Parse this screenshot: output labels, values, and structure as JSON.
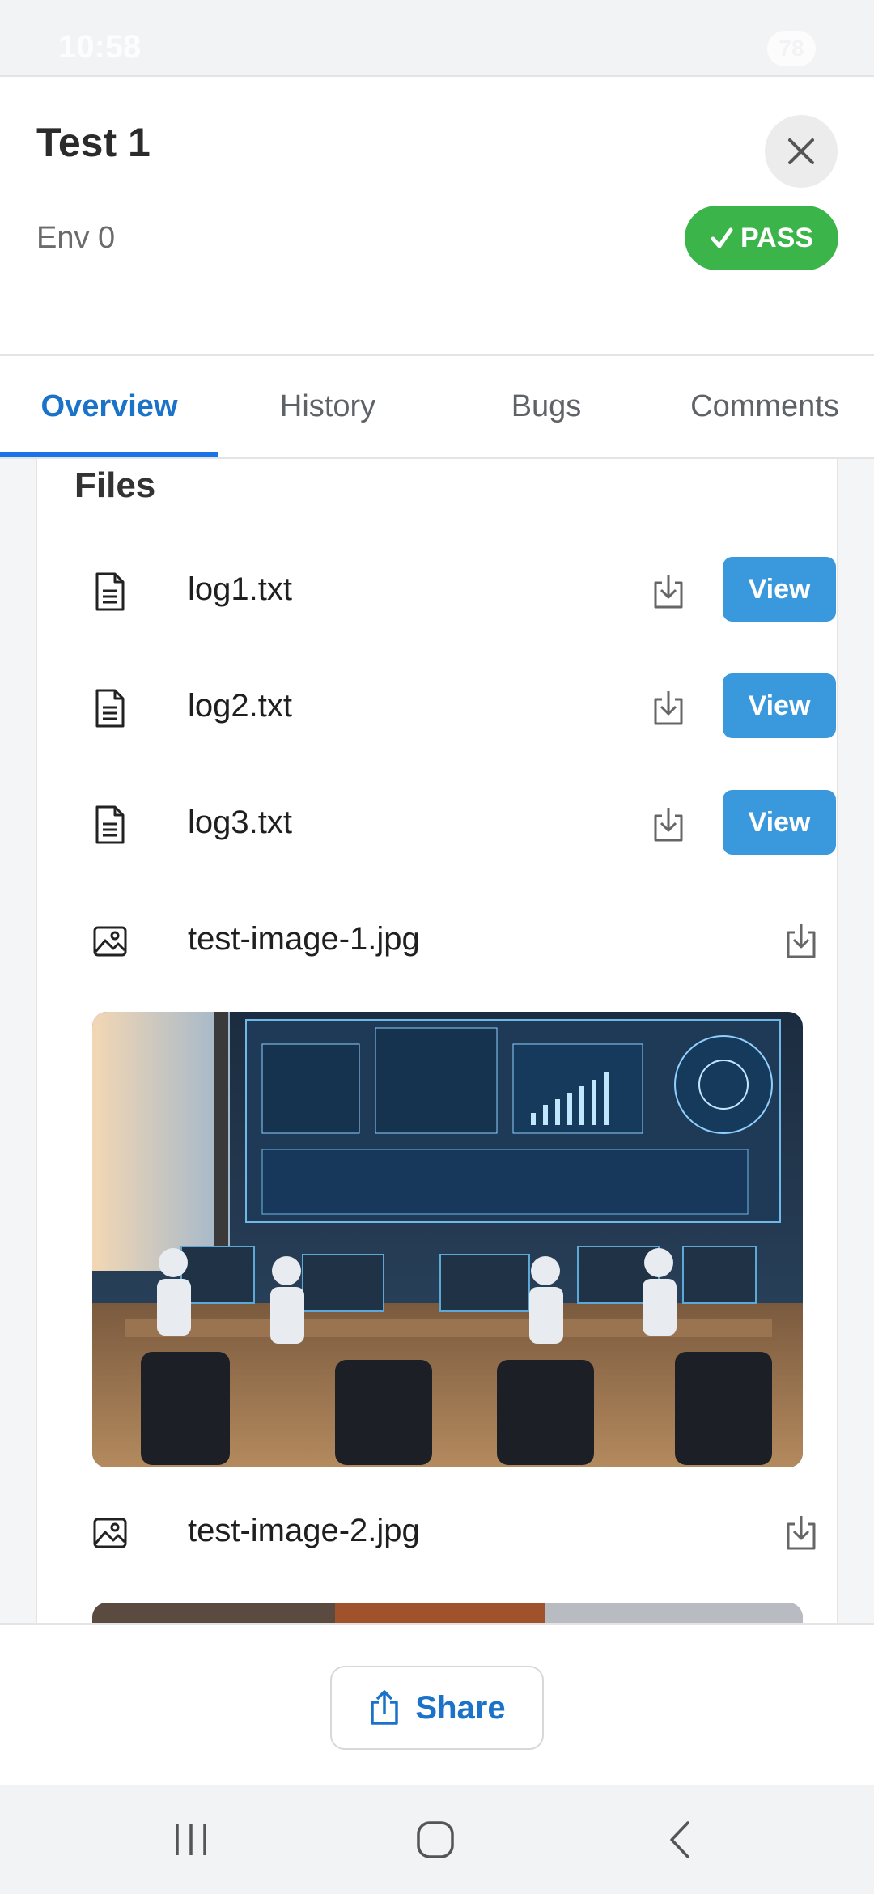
{
  "status_bar": {
    "time": "10:58",
    "battery": "78"
  },
  "header": {
    "title": "Test 1",
    "subtitle": "Env 0",
    "status_badge": "PASS",
    "status_color": "#3bb54a"
  },
  "tabs": [
    {
      "label": "Overview",
      "active": true
    },
    {
      "label": "History",
      "active": false
    },
    {
      "label": "Bugs",
      "active": false
    },
    {
      "label": "Comments",
      "active": false
    }
  ],
  "files": {
    "heading": "Files",
    "text_files": [
      {
        "name": "log1.txt",
        "view_label": "View"
      },
      {
        "name": "log2.txt",
        "view_label": "View"
      },
      {
        "name": "log3.txt",
        "view_label": "View"
      }
    ],
    "images": [
      {
        "name": "test-image-1.jpg",
        "alt": "AI office illustration with people at computer desks and large data screens"
      },
      {
        "name": "test-image-2.jpg",
        "alt": "Image preview"
      }
    ]
  },
  "footer": {
    "share_label": "Share"
  },
  "accent_color": "#1a73c8",
  "button_color": "#3a99dc"
}
